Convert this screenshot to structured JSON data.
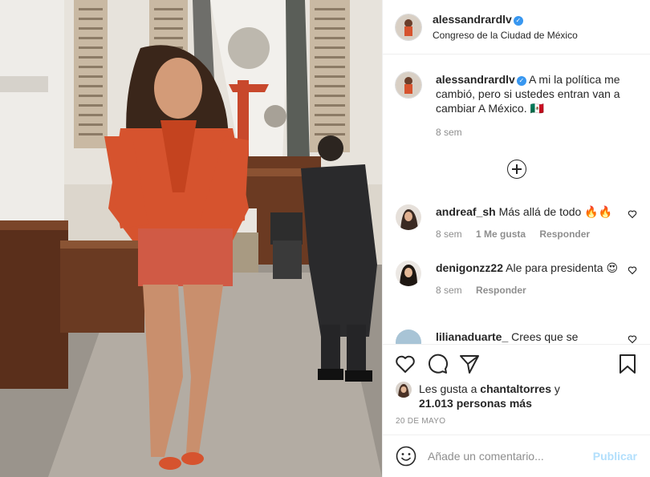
{
  "post": {
    "username": "alessandrardlv",
    "location": "Congreso de la Ciudad de México",
    "caption_user": "alessandrardlv",
    "caption_text": "A mi la política me cambió, pero si ustedes entran van a cambiar A México. 🇲🇽",
    "caption_age": "8 sem"
  },
  "comments": [
    {
      "user": "andreaf_sh",
      "text": "Más allá de todo 🔥🔥",
      "age": "8 sem",
      "likes": "1 Me gusta",
      "reply": "Responder"
    },
    {
      "user": "denigonzz22",
      "text": "Ale para presidenta 😍",
      "age": "8 sem",
      "reply": "Responder"
    },
    {
      "user": "lilianaduarte_",
      "text": "Crees que se"
    }
  ],
  "likes": {
    "prefix": "Les gusta a",
    "user": "chantaltorres",
    "mid": "y",
    "others": "21.013 personas más"
  },
  "date": "20 DE MAYO",
  "composer": {
    "placeholder": "Añade un comentario...",
    "publish_label": "Publicar"
  },
  "icons": {
    "heart": "heart-icon",
    "comment": "comment-bubble-icon",
    "share": "paper-plane-icon",
    "save": "bookmark-icon",
    "emoji": "smiley-icon",
    "more": "plus-circle-icon",
    "verified": "verified-badge-icon"
  },
  "colors": {
    "verified": "#3897f0",
    "muted": "#8e8e8e",
    "publish_disabled": "#b2dffc"
  }
}
